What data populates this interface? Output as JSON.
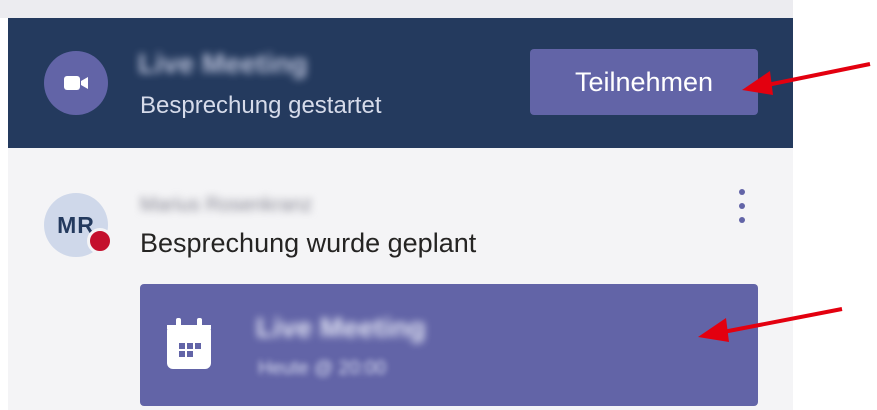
{
  "meeting_banner": {
    "meeting_name": "Live Meeting",
    "status": "Besprechung gestartet",
    "join_label": "Teilnehmen",
    "icon": "video-camera-icon"
  },
  "post": {
    "avatar_initials": "MR",
    "author": "Marius Rosenkranz",
    "message": "Besprechung wurde geplant",
    "more_icon": "more-vertical-icon",
    "presence_color": "#c4102d"
  },
  "meeting_card": {
    "title": "Live Meeting",
    "time": "Heute @ 20:00",
    "icon": "calendar-icon"
  },
  "colors": {
    "banner_bg": "#243a5e",
    "accent": "#6264a7",
    "annotation_arrow": "#e3000f"
  }
}
